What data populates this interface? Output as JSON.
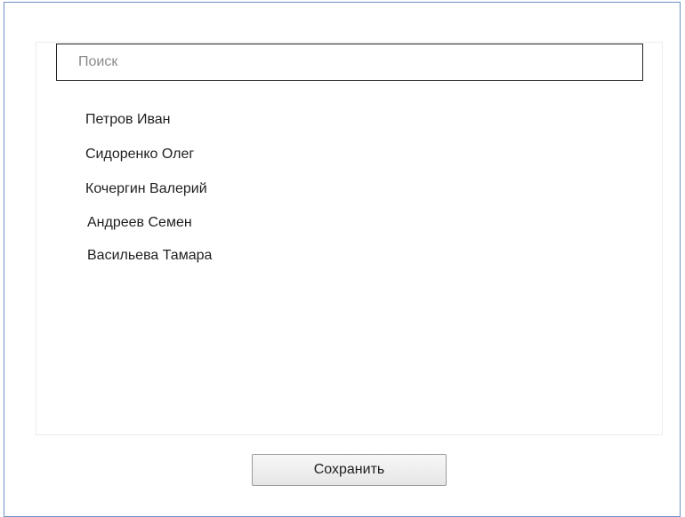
{
  "search": {
    "placeholder": "Поиск",
    "value": ""
  },
  "people": {
    "items": [
      {
        "label": "Петров Иван"
      },
      {
        "label": "Сидоренко Олег"
      },
      {
        "label": "Кочергин Валерий"
      },
      {
        "label": "Андреев Семен"
      },
      {
        "label": "Васильева Тамара"
      }
    ]
  },
  "actions": {
    "save_label": "Сохранить"
  },
  "colors": {
    "window_border": "#6f90c4",
    "search_border": "#222222",
    "button_border": "#9a9a9a"
  }
}
